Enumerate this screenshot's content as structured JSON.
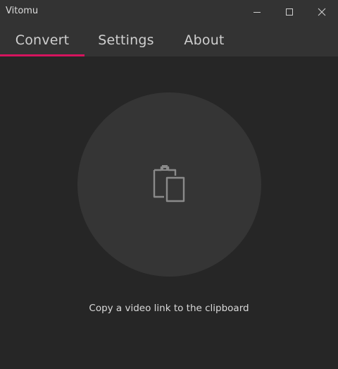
{
  "window": {
    "title": "Vitomu"
  },
  "titlebar": {
    "minimize_icon": "minimize-icon",
    "maximize_icon": "maximize-icon",
    "close_icon": "close-icon"
  },
  "tabs": [
    {
      "label": "Convert",
      "selected": true
    },
    {
      "label": "Settings",
      "selected": false
    },
    {
      "label": "About",
      "selected": false
    }
  ],
  "colors": {
    "accent": "#d6145e",
    "background": "#262626",
    "chrome": "#333333",
    "circle": "#353535"
  },
  "main": {
    "icon": "clipboard-icon",
    "hint": "Copy a video link to the clipboard"
  }
}
